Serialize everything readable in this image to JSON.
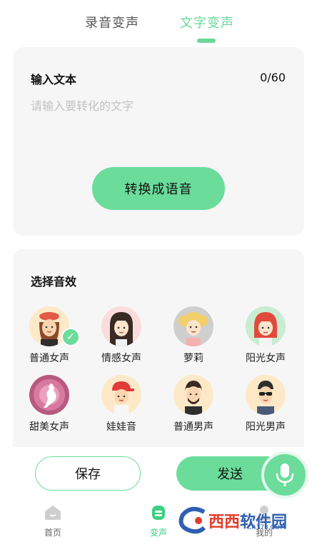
{
  "tabs": [
    {
      "label": "录音变声",
      "active": false
    },
    {
      "label": "文字变声",
      "active": true
    }
  ],
  "text_card": {
    "title": "输入文本",
    "counter": "0/60",
    "placeholder": "请输入要转化的文字",
    "convert_label": "转换成语音"
  },
  "effects_card": {
    "title": "选择音效",
    "voices": [
      {
        "label": "普通女声",
        "selected": true,
        "icon": "girl-hat-avatar-icon"
      },
      {
        "label": "情感女声",
        "selected": false,
        "icon": "girl-longhair-avatar-icon"
      },
      {
        "label": "萝莉",
        "selected": false,
        "icon": "blonde-girl-avatar-icon"
      },
      {
        "label": "阳光女声",
        "selected": false,
        "icon": "redhair-girl-avatar-icon"
      },
      {
        "label": "甜美女声",
        "selected": false,
        "icon": "silhouette-woman-avatar-icon"
      },
      {
        "label": "娃娃音",
        "selected": false,
        "icon": "boy-redcap-avatar-icon"
      },
      {
        "label": "普通男声",
        "selected": false,
        "icon": "man-beard-avatar-icon"
      },
      {
        "label": "阳光男声",
        "selected": false,
        "icon": "man-sunglasses-avatar-icon"
      }
    ]
  },
  "actions": {
    "save_label": "保存",
    "send_label": "发送",
    "mic_icon": "microphone-icon"
  },
  "nav": [
    {
      "label": "首页",
      "icon": "home-icon",
      "active": false
    },
    {
      "label": "变声",
      "icon": "voice-change-icon",
      "active": true
    },
    {
      "label": "我的",
      "icon": "profile-icon",
      "active": false
    }
  ],
  "watermark": {
    "logo_a": "西西",
    "logo_b": "软件园",
    "sub": "CR173.COM"
  },
  "colors": {
    "accent": "#6bdc9a",
    "card_bg": "#f6f6f6",
    "placeholder": "#c2c2c2"
  }
}
